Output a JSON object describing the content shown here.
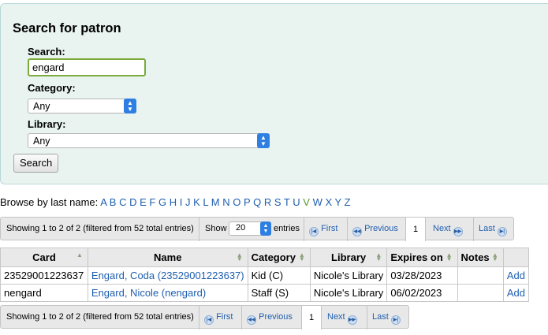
{
  "search_form": {
    "title": "Search for patron",
    "search_label": "Search:",
    "search_value": "engard",
    "category_label": "Category:",
    "category_value": "Any",
    "library_label": "Library:",
    "library_value": "Any",
    "submit_label": "Search"
  },
  "browse": {
    "label": "Browse by last name:",
    "letters": [
      "A",
      "B",
      "C",
      "D",
      "E",
      "F",
      "G",
      "H",
      "I",
      "J",
      "K",
      "L",
      "M",
      "N",
      "O",
      "P",
      "Q",
      "R",
      "S",
      "T",
      "U",
      "V",
      "W",
      "X",
      "Y",
      "Z"
    ],
    "selected": "V"
  },
  "pager": {
    "info": "Showing 1 to 2 of 2 (filtered from 52 total entries)",
    "show_label": "Show",
    "page_size": "20",
    "entries_label": "entries",
    "first": "First",
    "previous": "Previous",
    "current_page": "1",
    "next": "Next",
    "last": "Last"
  },
  "table": {
    "headers": {
      "card": "Card",
      "name": "Name",
      "category": "Category",
      "library": "Library",
      "expires": "Expires on",
      "notes": "Notes"
    },
    "rows": [
      {
        "card": "23529001223637",
        "name": "Engard, Coda (23529001223637)",
        "category": "Kid (C)",
        "library": "Nicole's Library",
        "expires": "03/28/2023",
        "notes": "",
        "action": "Add"
      },
      {
        "card": "nengard",
        "name": "Engard, Nicole (nengard)",
        "category": "Staff (S)",
        "library": "Nicole's Library",
        "expires": "06/02/2023",
        "notes": "",
        "action": "Add"
      }
    ]
  },
  "colors": {
    "panel_bg": "#e9f4f1",
    "link": "#1e5fb0",
    "focus_border": "#7bab3b",
    "select_arrow": "#2f7fe3"
  }
}
